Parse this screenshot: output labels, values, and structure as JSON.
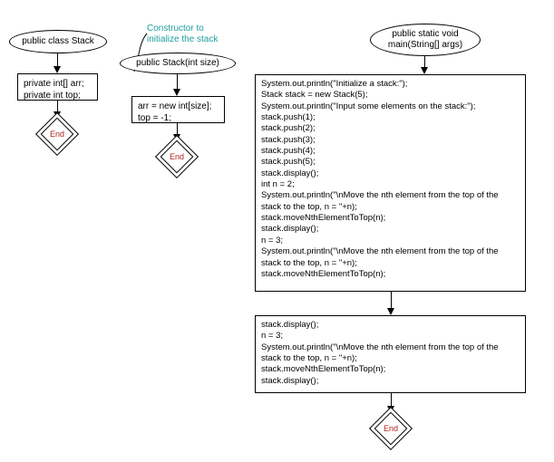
{
  "class_node": {
    "label": "public class Stack"
  },
  "class_fields": {
    "text": "private int[] arr;\nprivate int top;"
  },
  "constructor_comment": "Constructor to\ninitialize the stack",
  "constructor_node": {
    "label": "public Stack(int size)"
  },
  "constructor_body": {
    "text": "arr = new int[size];\ntop = -1;"
  },
  "main_node": {
    "label": "public static void\nmain(String[] args)"
  },
  "main_body1": {
    "text": "System.out.println(\"Initialize a stack:\");\nStack stack = new Stack(5);\nSystem.out.println(\"Input some elements on the stack:\");\nstack.push(1);\nstack.push(2);\nstack.push(3);\nstack.push(4);\nstack.push(5);\nstack.display();\nint n = 2;\nSystem.out.println(\"\\nMove the nth element from the top of the\nstack to the top, n = \"+n);\nstack.moveNthElementToTop(n);\nstack.display();\nn = 3;\nSystem.out.println(\"\\nMove the nth element from the top of the\nstack to the top, n = \"+n);\nstack.moveNthElementToTop(n);"
  },
  "main_body2": {
    "text": "stack.display();\nn = 3;\nSystem.out.println(\"\\nMove the nth element from the top of the\nstack to the top, n = \"+n);\nstack.moveNthElementToTop(n);\nstack.display();"
  },
  "end_label": "End"
}
